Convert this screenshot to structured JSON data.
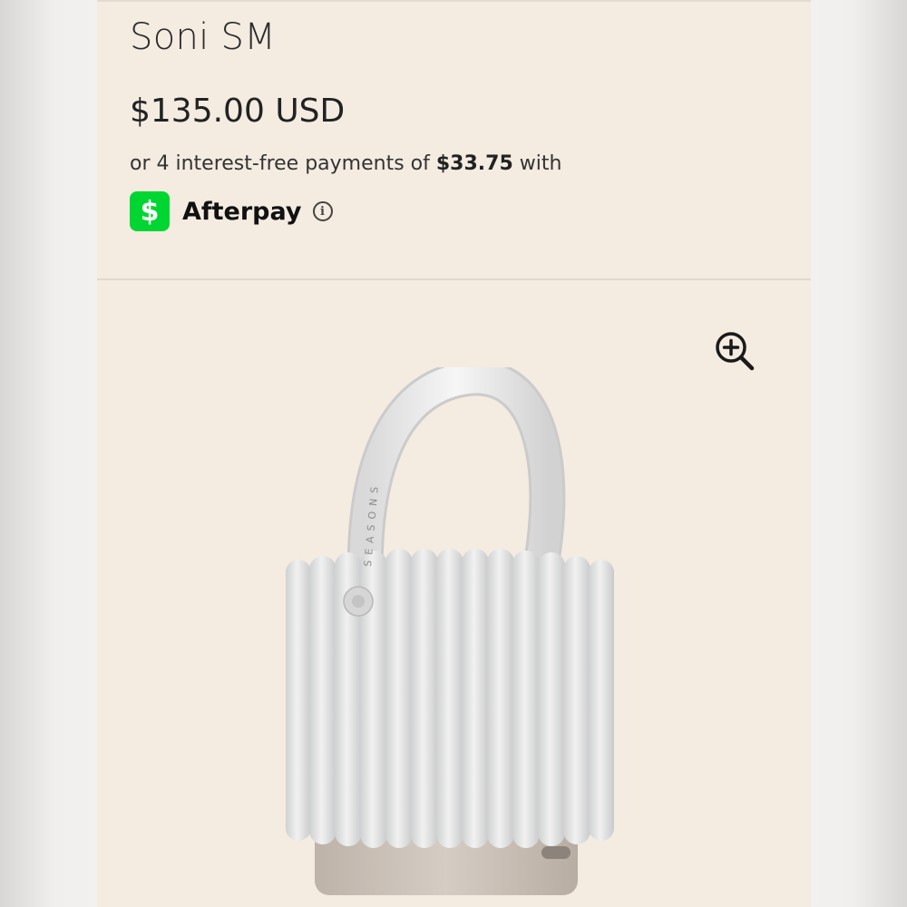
{
  "product": {
    "title": "Soni SM",
    "price": "$135.00 USD"
  },
  "installments": {
    "prefix": "or 4 interest-free payments of ",
    "amount": "$33.75",
    "suffix": " with"
  },
  "afterpay": {
    "icon_glyph": "$",
    "label": "Afterpay",
    "info_glyph": "i",
    "brand_color": "#00d632"
  },
  "image": {
    "handle_text": "SEASONS"
  },
  "icons": {
    "zoom": "zoom-in-icon",
    "cash": "cash-app-icon",
    "info": "info-icon"
  }
}
